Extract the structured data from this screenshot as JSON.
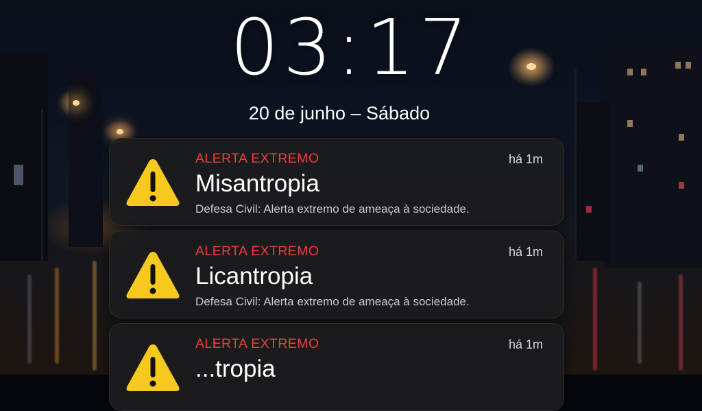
{
  "lockscreen": {
    "time": "03:17",
    "date": "20 de junho – Sábado"
  },
  "notifications": [
    {
      "header": "ALERTA EXTREMO",
      "time": "há 1m",
      "title": "Misantropia",
      "body": "Defesa Civil: Alerta extremo de ameaça à sociedade.",
      "icon": "warning-triangle-icon"
    },
    {
      "header": "ALERTA EXTREMO",
      "time": "há 1m",
      "title": "Licantropia",
      "body": "Defesa Civil: Alerta extremo de ameaça à sociedade.",
      "icon": "warning-triangle-icon"
    },
    {
      "header": "ALERTA EXTREMO",
      "time": "há 1m",
      "title": "...tropia",
      "icon": "warning-triangle-icon"
    }
  ],
  "colors": {
    "alert_red": "#e8403a",
    "warning_yellow": "#f7c81e",
    "card_bg": "#1c1c1e"
  }
}
